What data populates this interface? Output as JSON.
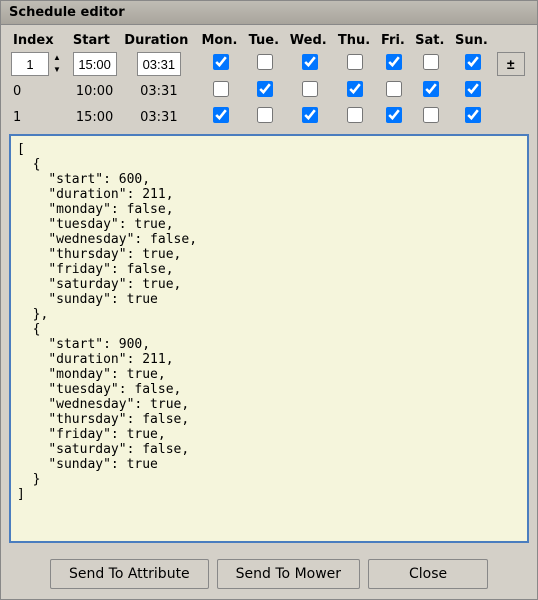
{
  "window": {
    "title": "Schedule editor"
  },
  "table": {
    "headers": [
      "Index",
      "Start",
      "Duration",
      "Mon.",
      "Tue.",
      "Wed.",
      "Thu.",
      "Fri.",
      "Sat.",
      "Sun."
    ],
    "input_row": {
      "index_value": "1",
      "start_value": "15:00",
      "duration_value": "03:31",
      "mon": true,
      "tue": false,
      "wed": true,
      "thu": false,
      "fri": true,
      "sat": false,
      "sun": true
    },
    "data_rows": [
      {
        "index": "0",
        "start": "10:00",
        "duration": "03:31",
        "mon": false,
        "tue": true,
        "wed": false,
        "thu": true,
        "fri": false,
        "sat": true,
        "sun": true
      },
      {
        "index": "1",
        "start": "15:00",
        "duration": "03:31",
        "mon": true,
        "tue": false,
        "wed": true,
        "thu": false,
        "fri": true,
        "sat": false,
        "sun": true
      }
    ]
  },
  "json_content": "[\n  {\n    \"start\": 600,\n    \"duration\": 211,\n    \"monday\": false,\n    \"tuesday\": true,\n    \"wednesday\": false,\n    \"thursday\": true,\n    \"friday\": false,\n    \"saturday\": true,\n    \"sunday\": true\n  },\n  {\n    \"start\": 900,\n    \"duration\": 211,\n    \"monday\": true,\n    \"tuesday\": false,\n    \"wednesday\": true,\n    \"thursday\": false,\n    \"friday\": true,\n    \"saturday\": false,\n    \"sunday\": true\n  }\n]",
  "buttons": {
    "send_attribute": "Send To Attribute",
    "send_mower": "Send To Mower",
    "close": "Close"
  }
}
